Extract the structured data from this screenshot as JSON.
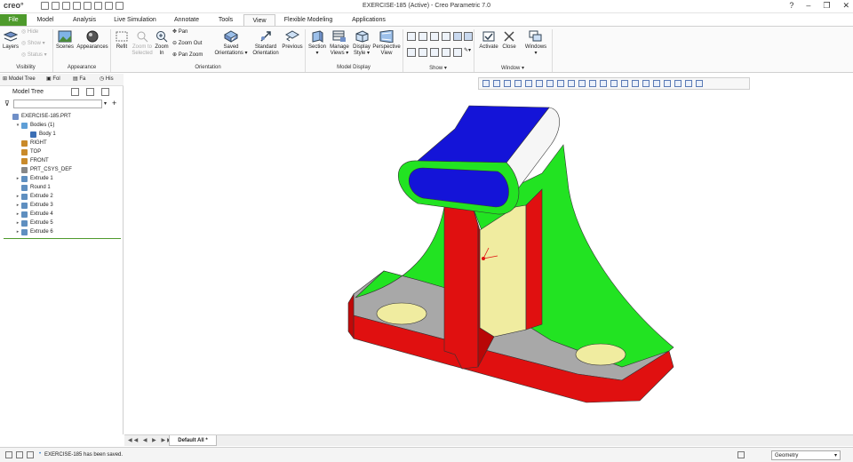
{
  "app": {
    "logo": "creo°",
    "title": "EXERCISE-185 (Active) - Creo Parametric 7.0",
    "window_controls": [
      "?",
      "–",
      "❐",
      "✕"
    ]
  },
  "tabs": [
    "File",
    "Model",
    "Analysis",
    "Live Simulation",
    "Annotate",
    "Tools",
    "View",
    "Flexible Modeling",
    "Applications"
  ],
  "active_tab": "View",
  "ribbon": {
    "visibility": {
      "layers": "Layers",
      "hide": "Hide",
      "show": "Show",
      "status": "Status",
      "group": "Visibility"
    },
    "appearance": {
      "scenes": "Scenes",
      "appearances": "Appearances",
      "group": "Appearance"
    },
    "orientation": {
      "refit": "Refit",
      "zoom_selected": [
        "Zoom to",
        "Selected"
      ],
      "zoom_in": [
        "Zoom",
        "In"
      ],
      "pan": "Pan",
      "zoom_out": "Zoom Out",
      "pan_zoom": "Pan Zoom",
      "saved": [
        "Saved",
        "Orientations"
      ],
      "standard": [
        "Standard",
        "Orientation"
      ],
      "previous": "Previous",
      "group": "Orientation"
    },
    "model_display": {
      "section": "Section",
      "manage_views": [
        "Manage",
        "Views"
      ],
      "display_style": [
        "Display",
        "Style"
      ],
      "perspective": [
        "Perspective",
        "View"
      ],
      "group": "Model Display"
    },
    "show": {
      "group": "Show"
    },
    "window": {
      "activate": "Activate",
      "close": "Close",
      "windows": "Windows",
      "group": "Window"
    }
  },
  "panel": {
    "tabs": [
      "Model Tree",
      "Fol",
      "Fa",
      "His"
    ],
    "tree_header": "Model Tree",
    "tree": [
      {
        "label": "EXERCISE-185.PRT",
        "indent": 0,
        "toggle": "",
        "icon": "part-icon"
      },
      {
        "label": "Bodies (1)",
        "indent": 1,
        "toggle": "▾",
        "icon": "bodies-icon"
      },
      {
        "label": "Body 1",
        "indent": 2,
        "toggle": "",
        "icon": "body-icon"
      },
      {
        "label": "RIGHT",
        "indent": 1,
        "toggle": "",
        "icon": "datum-plane-icon"
      },
      {
        "label": "TOP",
        "indent": 1,
        "toggle": "",
        "icon": "datum-plane-icon"
      },
      {
        "label": "FRONT",
        "indent": 1,
        "toggle": "",
        "icon": "datum-plane-icon"
      },
      {
        "label": "PRT_CSYS_DEF",
        "indent": 1,
        "toggle": "",
        "icon": "csys-icon"
      },
      {
        "label": "Extrude 1",
        "indent": 1,
        "toggle": "▸",
        "icon": "extrude-icon"
      },
      {
        "label": "Round 1",
        "indent": 1,
        "toggle": "",
        "icon": "round-icon"
      },
      {
        "label": "Extrude 2",
        "indent": 1,
        "toggle": "▸",
        "icon": "extrude-icon"
      },
      {
        "label": "Extrude 3",
        "indent": 1,
        "toggle": "▸",
        "icon": "extrude-icon"
      },
      {
        "label": "Extrude 4",
        "indent": 1,
        "toggle": "▸",
        "icon": "extrude-icon"
      },
      {
        "label": "Extrude 5",
        "indent": 1,
        "toggle": "▸",
        "icon": "extrude-icon"
      },
      {
        "label": "Extrude 6",
        "indent": 1,
        "toggle": "▸",
        "icon": "extrude-icon"
      }
    ]
  },
  "bottom_tab": "Default All *",
  "status": {
    "message": "EXERCISE-185 has been saved.",
    "filter": "Geometry"
  },
  "colors": {
    "accent_green": "#4e9a2c",
    "model_red": "#e01010",
    "model_green": "#22e322",
    "model_blue": "#1414d8",
    "model_gray": "#a8a8a8",
    "model_yellow": "#f0eca0"
  }
}
